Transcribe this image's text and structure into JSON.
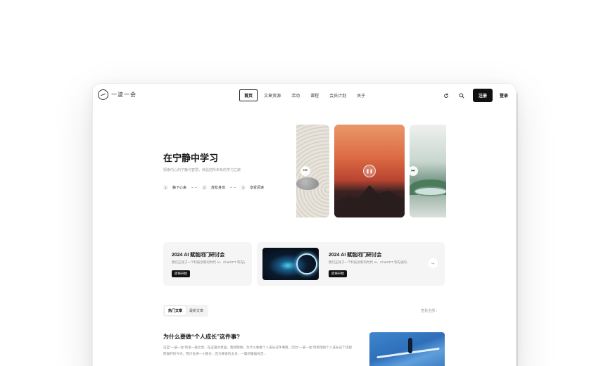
{
  "nav": {
    "logo_text": "一波一会",
    "links": [
      {
        "label": "首页",
        "active": true
      },
      {
        "label": "文章资源"
      },
      {
        "label": "活动"
      },
      {
        "label": "课程"
      },
      {
        "label": "会员计划"
      },
      {
        "label": "关于"
      }
    ],
    "icons": [
      "refresh-icon",
      "search-icon"
    ],
    "signup_label": "注册",
    "login_label": "登录"
  },
  "hero": {
    "title": "在宁静中学习",
    "subtitle": "探索内心的宁静与智慧，体验前所未有的学习之旅",
    "steps": [
      {
        "num": "1",
        "label": "静下心来"
      },
      {
        "num": "2",
        "label": "放松身体"
      },
      {
        "num": "3",
        "label": "享受阅读"
      }
    ]
  },
  "events": [
    {
      "title": "2024 AI 赋能闭门研讨会",
      "desc": "我们正处于一个科技创新的时代 AI、ChatGPT 等先进的...",
      "button": "即将开始"
    },
    {
      "title": "2024 AI 赋能闭门研讨会",
      "desc": "我们正处于一个科技创新的时代 AI、ChatGPT 等先进的...",
      "button": "即将开始"
    }
  ],
  "articles": {
    "tabs": [
      {
        "label": "热门文章",
        "active": true
      },
      {
        "label": "最新文章"
      }
    ],
    "view_all": "查看全部 ›",
    "items": [
      {
        "title": "为什么要做“个人成长”这件事?",
        "excerpt": "这是“一波一会”的第一篇文章。在这篇文章里，我想聊聊，为什么要做个人成长这件事情。因为“一波一会”项目围绕个人成长这个话题而展开的今天，我只会讲一小部分，因为要讲的太多，一篇的篇幅肯定..."
      }
    ]
  },
  "colors": {
    "accent": "#111111",
    "card_bg": "#f5f5f5"
  }
}
